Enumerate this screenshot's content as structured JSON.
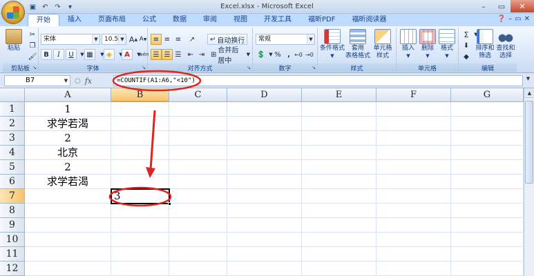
{
  "window": {
    "title": "Excel.xlsx - Microsoft Excel"
  },
  "qat": {
    "save_icon": "save-icon",
    "undo_icon": "undo-icon",
    "redo_icon": "redo-icon"
  },
  "ribbon_tabs": [
    "开始",
    "插入",
    "页面布局",
    "公式",
    "数据",
    "审阅",
    "视图",
    "开发工具",
    "福昕PDF",
    "福昕阅读器"
  ],
  "clipboard": {
    "paste": "粘贴",
    "label": "剪贴板"
  },
  "font": {
    "name": "宋体",
    "size": "10.5",
    "label": "字体",
    "bold": "B",
    "italic": "I",
    "underline": "U",
    "grow": "A",
    "shrink": "A",
    "color_letter": "A",
    "phonetic": "wén"
  },
  "alignment": {
    "wrap": "自动换行",
    "merge": "合并后居中",
    "label": "对齐方式"
  },
  "number": {
    "format": "常规",
    "percent": "%",
    "comma": ",",
    "label": "数字"
  },
  "styles": {
    "conditional": "条件格式",
    "table": "套用\n表格格式",
    "cell": "单元格\n样式",
    "label": "样式"
  },
  "cells": {
    "insert": "插入",
    "delete": "删除",
    "format": "格式",
    "label": "单元格"
  },
  "editing": {
    "sum": "Σ",
    "sort": "排序和\n筛选",
    "find": "查找和\n选择",
    "label": "编辑"
  },
  "formula_bar": {
    "namebox": "B7",
    "fx": "fx",
    "formula": "=COUNTIF(A1:A6,\"<10\")"
  },
  "columns": [
    "A",
    "B",
    "C",
    "D",
    "E",
    "F",
    "G"
  ],
  "rows": [
    "1",
    "2",
    "3",
    "4",
    "5",
    "6",
    "7",
    "8",
    "9",
    "10",
    "11",
    "12"
  ],
  "cells_data": {
    "A1": "1",
    "A2": "求学若渴",
    "A3": "2",
    "A4": "北京",
    "A5": "2",
    "A6": "求学若渴",
    "B7": "3"
  },
  "active_cell": "B7",
  "colors": {
    "ribbon_blue": "#bfdbff",
    "selected_header": "#f6c56d",
    "annotation_red": "#e0241b"
  }
}
